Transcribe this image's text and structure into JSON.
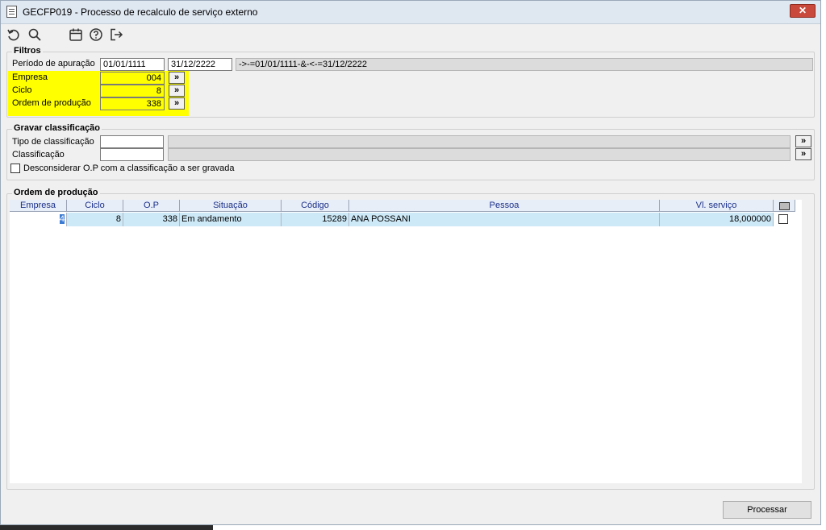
{
  "window": {
    "title": "GECFP019 - Processo de recalculo de serviço externo",
    "close_label": "✕"
  },
  "filtros": {
    "title": "Filtros",
    "periodo_label": "Período de apuração",
    "periodo_inicio": "01/01/1111",
    "periodo_fim": "31/12/2222",
    "periodo_expr": "->-=01/01/1111-&-<-=31/12/2222",
    "empresa_label": "Empresa",
    "empresa_value": "004",
    "ciclo_label": "Ciclo",
    "ciclo_value": "8",
    "op_label": "Ordem de produção",
    "op_value": "338",
    "lookup_label": "»"
  },
  "gravar": {
    "title": "Gravar classificação",
    "tipo_label": "Tipo de classificação",
    "classificacao_label": "Classificação",
    "checkbox_label": "Desconsiderar O.P com a classificação a ser gravada",
    "lookup_label": "»"
  },
  "ordem": {
    "title": "Ordem de produção",
    "columns": [
      "Empresa",
      "Ciclo",
      "O.P",
      "Situação",
      "Código",
      "Pessoa",
      "Vl. serviço"
    ],
    "row": {
      "empresa": "4",
      "ciclo": "8",
      "op": "338",
      "situacao": "Em andamento",
      "codigo": "15289",
      "pessoa": "ANA POSSANI",
      "valor": "18,000000"
    }
  },
  "footer": {
    "processar_label": "Processar"
  },
  "icons": [
    "undo-icon",
    "search-icon",
    "calendar-icon",
    "help-icon",
    "exit-icon"
  ],
  "colors": {
    "highlight": "#ffff00",
    "row_selected": "#cde9f7",
    "header_text": "#1a2f8a"
  }
}
